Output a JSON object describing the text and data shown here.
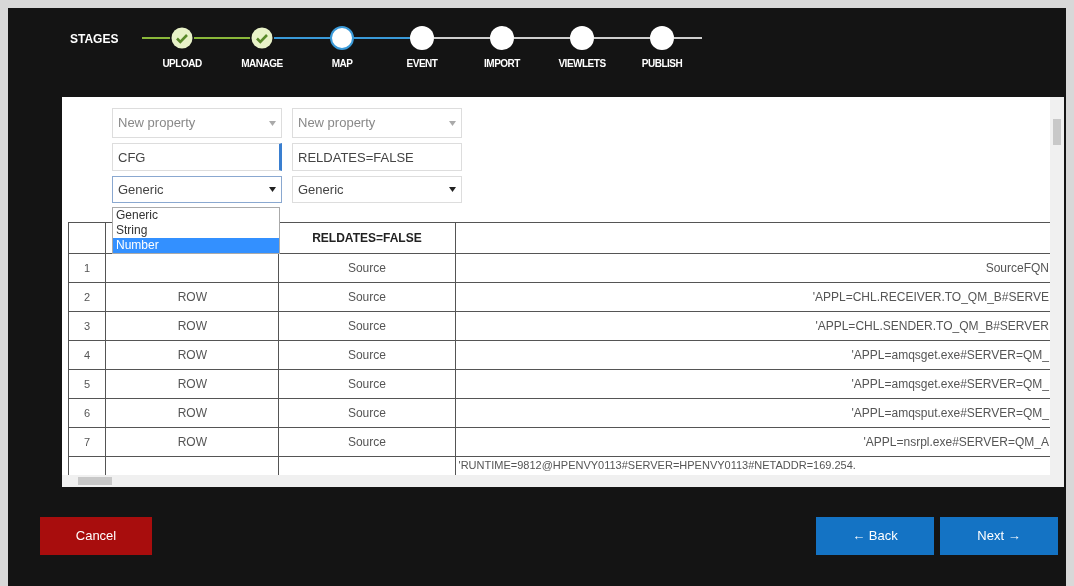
{
  "stages": {
    "label": "STAGES",
    "steps": [
      {
        "label": "UPLOAD",
        "completed": true,
        "selected": false
      },
      {
        "label": "MANAGE",
        "completed": true,
        "selected": false
      },
      {
        "label": "MAP",
        "completed": false,
        "selected": true
      },
      {
        "label": "EVENT",
        "completed": false,
        "selected": false
      },
      {
        "label": "IMPORT",
        "completed": false,
        "selected": false
      },
      {
        "label": "VIEWLETS",
        "completed": false,
        "selected": false
      },
      {
        "label": "PUBLISH",
        "completed": false,
        "selected": false
      }
    ]
  },
  "properties": [
    {
      "property_placeholder": "New property",
      "value": "CFG",
      "focused": true,
      "type": "Generic",
      "expanded": true,
      "options": [
        {
          "label": "Generic",
          "selected": false
        },
        {
          "label": "String",
          "selected": false
        },
        {
          "label": "Number",
          "selected": true
        }
      ]
    },
    {
      "property_placeholder": "New property",
      "value": "RELDATES=FALSE",
      "focused": false,
      "type": "Generic",
      "expanded": false
    }
  ],
  "table": {
    "columns": [
      "",
      "",
      "RELDATES=FALSE",
      ""
    ],
    "rows": [
      [
        "1",
        "",
        "Source",
        "SourceFQN"
      ],
      [
        "2",
        "ROW",
        "Source",
        "'APPL=CHL.RECEIVER.TO_QM_B#SERVE"
      ],
      [
        "3",
        "ROW",
        "Source",
        "'APPL=CHL.SENDER.TO_QM_B#SERVER"
      ],
      [
        "4",
        "ROW",
        "Source",
        "'APPL=amqsget.exe#SERVER=QM_"
      ],
      [
        "5",
        "ROW",
        "Source",
        "'APPL=amqsget.exe#SERVER=QM_"
      ],
      [
        "6",
        "ROW",
        "Source",
        "'APPL=amqsput.exe#SERVER=QM_"
      ],
      [
        "7",
        "ROW",
        "Source",
        "'APPL=nsrpl.exe#SERVER=QM_A"
      ]
    ],
    "partial_row": "'RUNTIME=9812@HPENVY0113#SERVER=HPENVY0113#NETADDR=169.254."
  },
  "buttons": {
    "cancel": "Cancel",
    "back": "← Back",
    "next": "Next →"
  }
}
